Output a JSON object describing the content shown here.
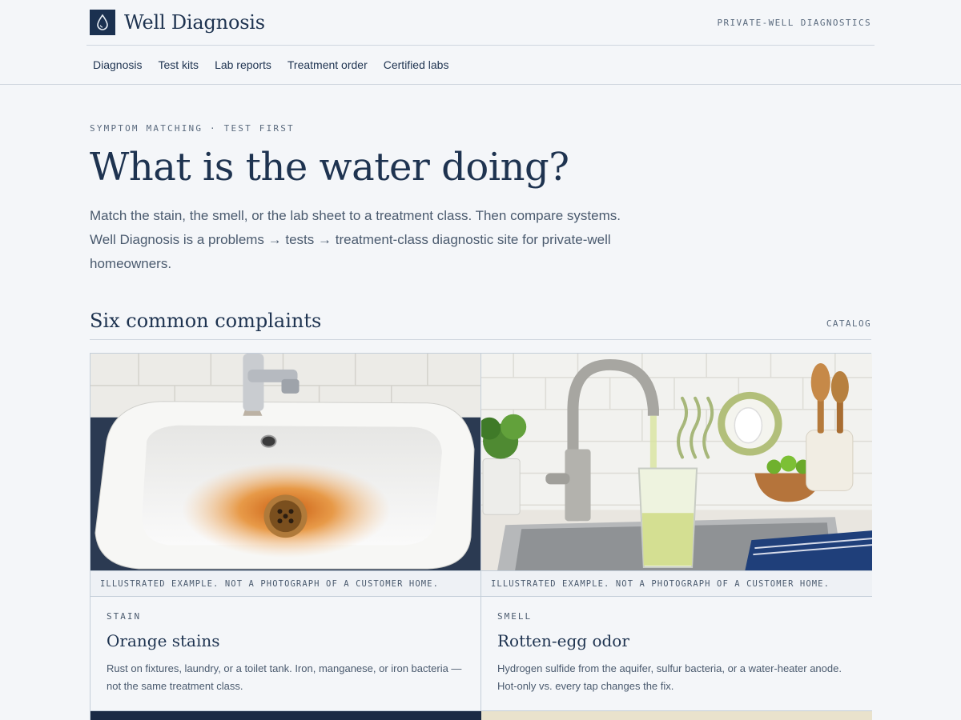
{
  "header": {
    "brand": "Well Diagnosis",
    "tagline": "PRIVATE-WELL DIAGNOSTICS",
    "logo_icon": "water-drop-icon",
    "nav": [
      "Diagnosis",
      "Test kits",
      "Lab reports",
      "Treatment order",
      "Certified labs"
    ]
  },
  "hero": {
    "eyebrow": "SYMPTOM MATCHING · TEST FIRST",
    "title": "What is the water doing?",
    "description": "Match the stain, the smell, or the lab sheet to a treatment class. Then compare systems. Well Diagnosis is a problems → tests → treatment-class diagnostic site for private-well homeowners."
  },
  "section": {
    "title": "Six common complaints",
    "tag": "CATALOG"
  },
  "cards": [
    {
      "kind": "STAIN",
      "title": "Orange stains",
      "description": "Rust on fixtures, laundry, or a toilet tank. Iron, manganese, or iron bacteria — not the same treatment class.",
      "caption": "ILLUSTRATED EXAMPLE. NOT A PHOTOGRAPH OF A CUSTOMER HOME."
    },
    {
      "kind": "SMELL",
      "title": "Rotten-egg odor",
      "description": "Hydrogen sulfide from the aquifer, sulfur bacteria, or a water-heater anode. Hot-only vs. every tap changes the fix.",
      "caption": "ILLUSTRATED EXAMPLE. NOT A PHOTOGRAPH OF A CUSTOMER HOME."
    }
  ],
  "colors": {
    "background": "#f4f6f9",
    "ink": "#1e3350",
    "muted": "#4a5a6e",
    "rule": "#cfd6df",
    "rust": "#d9731a"
  }
}
